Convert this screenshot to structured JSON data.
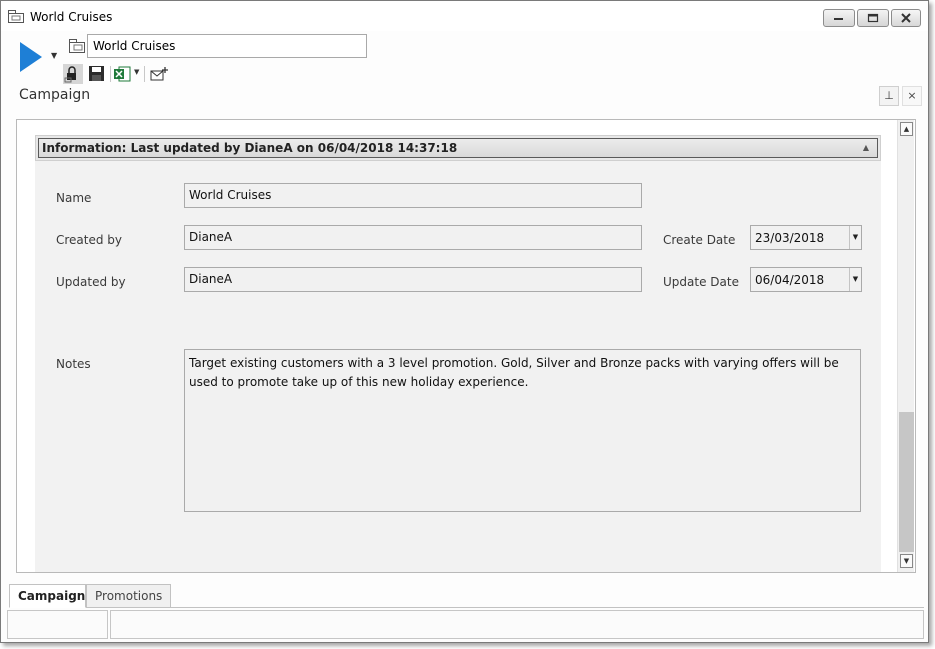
{
  "window": {
    "title": "World Cruises"
  },
  "toolbar": {
    "name_value": "World Cruises",
    "icons": [
      "play-icon",
      "dropdown-arrow-icon",
      "campaign-icon",
      "lock-icon",
      "save-icon",
      "excel-export-icon",
      "email-icon"
    ]
  },
  "section": {
    "title": "Campaign"
  },
  "info": {
    "text": "Information: Last updated by DianeA on 06/04/2018 14:37:18"
  },
  "form": {
    "name_label": "Name",
    "name_value": "World Cruises",
    "created_by_label": "Created by",
    "created_by_value": "DianeA",
    "updated_by_label": "Updated by",
    "updated_by_value": "DianeA",
    "create_date_label": "Create Date",
    "create_date_value": "23/03/2018",
    "update_date_label": "Update Date",
    "update_date_value": "06/04/2018",
    "notes_label": "Notes",
    "notes_value": "Target existing customers with a 3 level promotion.  Gold, Silver and Bronze packs with varying offers will be used to promote take up of this new holiday experience."
  },
  "tabs": [
    {
      "label": "Campaign",
      "active": true
    },
    {
      "label": "Promotions",
      "active": false
    }
  ],
  "colors": {
    "accent": "#1e7fd6",
    "excel": "#1f7a3a"
  }
}
